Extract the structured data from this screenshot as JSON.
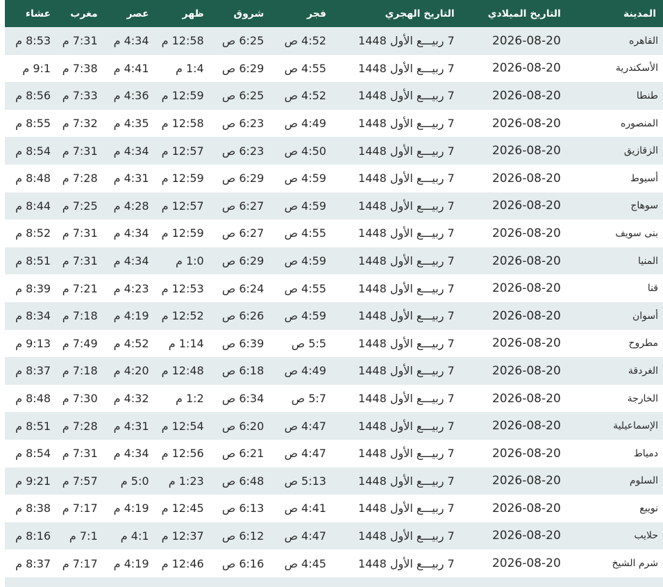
{
  "table": {
    "headers": {
      "city": "المدينة",
      "gregorian": "التاريخ الميلادي",
      "hijri": "التاريخ الهجري",
      "fajr": "فجر",
      "shuruq": "شروق",
      "dhuhr": "ظهر",
      "asr": "عصر",
      "maghrib": "مغرب",
      "isha": "عشاء"
    },
    "rows": [
      {
        "city": "القاهره",
        "gregorian": "2026-08-20",
        "hijri": "7 ربيـــع الأول 1448",
        "fajr": "4:52 ص",
        "shuruq": "6:25 ص",
        "dhuhr": "12:58 م",
        "asr": "4:34 م",
        "maghrib": "7:31 م",
        "isha": "8:53 م"
      },
      {
        "city": "الأسكندرية",
        "gregorian": "2026-08-20",
        "hijri": "7 ربيـــع الأول 1448",
        "fajr": "4:55 ص",
        "shuruq": "6:29 ص",
        "dhuhr": "1:4 م",
        "asr": "4:41 م",
        "maghrib": "7:38 م",
        "isha": "9:1 م"
      },
      {
        "city": "طنطا",
        "gregorian": "2026-08-20",
        "hijri": "7 ربيـــع الأول 1448",
        "fajr": "4:52 ص",
        "shuruq": "6:25 ص",
        "dhuhr": "12:59 م",
        "asr": "4:36 م",
        "maghrib": "7:33 م",
        "isha": "8:56 م"
      },
      {
        "city": "المنصوره",
        "gregorian": "2026-08-20",
        "hijri": "7 ربيـــع الأول 1448",
        "fajr": "4:49 ص",
        "shuruq": "6:23 ص",
        "dhuhr": "12:58 م",
        "asr": "4:35 م",
        "maghrib": "7:32 م",
        "isha": "8:55 م"
      },
      {
        "city": "الزقازيق",
        "gregorian": "2026-08-20",
        "hijri": "7 ربيـــع الأول 1448",
        "fajr": "4:50 ص",
        "shuruq": "6:23 ص",
        "dhuhr": "12:57 م",
        "asr": "4:34 م",
        "maghrib": "7:31 م",
        "isha": "8:54 م"
      },
      {
        "city": "أسيوط",
        "gregorian": "2026-08-20",
        "hijri": "7 ربيـــع الأول 1448",
        "fajr": "4:59 ص",
        "shuruq": "6:29 ص",
        "dhuhr": "12:59 م",
        "asr": "4:31 م",
        "maghrib": "7:28 م",
        "isha": "8:48 م"
      },
      {
        "city": "سوهاج",
        "gregorian": "2026-08-20",
        "hijri": "7 ربيـــع الأول 1448",
        "fajr": "4:59 ص",
        "shuruq": "6:27 ص",
        "dhuhr": "12:57 م",
        "asr": "4:28 م",
        "maghrib": "7:25 م",
        "isha": "8:44 م"
      },
      {
        "city": "بنى سويف",
        "gregorian": "2026-08-20",
        "hijri": "7 ربيـــع الأول 1448",
        "fajr": "4:55 ص",
        "shuruq": "6:27 ص",
        "dhuhr": "12:59 م",
        "asr": "4:34 م",
        "maghrib": "7:31 م",
        "isha": "8:52 م"
      },
      {
        "city": "المنيا",
        "gregorian": "2026-08-20",
        "hijri": "7 ربيـــع الأول 1448",
        "fajr": "4:59 ص",
        "shuruq": "6:29 ص",
        "dhuhr": "1:0 م",
        "asr": "4:34 م",
        "maghrib": "7:31 م",
        "isha": "8:51 م"
      },
      {
        "city": "قنا",
        "gregorian": "2026-08-20",
        "hijri": "7 ربيـــع الأول 1448",
        "fajr": "4:55 ص",
        "shuruq": "6:24 ص",
        "dhuhr": "12:53 م",
        "asr": "4:23 م",
        "maghrib": "7:21 م",
        "isha": "8:39 م"
      },
      {
        "city": "أسوان",
        "gregorian": "2026-08-20",
        "hijri": "7 ربيـــع الأول 1448",
        "fajr": "4:59 ص",
        "shuruq": "6:26 ص",
        "dhuhr": "12:52 م",
        "asr": "4:19 م",
        "maghrib": "7:18 م",
        "isha": "8:34 م"
      },
      {
        "city": "مطروح",
        "gregorian": "2026-08-20",
        "hijri": "7 ربيـــع الأول 1448",
        "fajr": "5:5 ص",
        "shuruq": "6:39 ص",
        "dhuhr": "1:14 م",
        "asr": "4:52 م",
        "maghrib": "7:49 م",
        "isha": "9:13 م"
      },
      {
        "city": "الغردقة",
        "gregorian": "2026-08-20",
        "hijri": "7 ربيـــع الأول 1448",
        "fajr": "4:49 ص",
        "shuruq": "6:18 ص",
        "dhuhr": "12:48 م",
        "asr": "4:20 م",
        "maghrib": "7:18 م",
        "isha": "8:37 م"
      },
      {
        "city": "الخارجة",
        "gregorian": "2026-08-20",
        "hijri": "7 ربيـــع الأول 1448",
        "fajr": "5:7 ص",
        "shuruq": "6:34 ص",
        "dhuhr": "1:2 م",
        "asr": "4:32 م",
        "maghrib": "7:30 م",
        "isha": "8:48 م"
      },
      {
        "city": "الإسماعيلية",
        "gregorian": "2026-08-20",
        "hijri": "7 ربيـــع الأول 1448",
        "fajr": "4:47 ص",
        "shuruq": "6:20 ص",
        "dhuhr": "12:54 م",
        "asr": "4:31 م",
        "maghrib": "7:28 م",
        "isha": "8:51 م"
      },
      {
        "city": "دمياط",
        "gregorian": "2026-08-20",
        "hijri": "7 ربيـــع الأول 1448",
        "fajr": "4:47 ص",
        "shuruq": "6:21 ص",
        "dhuhr": "12:56 م",
        "asr": "4:34 م",
        "maghrib": "7:31 م",
        "isha": "8:54 م"
      },
      {
        "city": "السلوم",
        "gregorian": "2026-08-20",
        "hijri": "7 ربيـــع الأول 1448",
        "fajr": "5:13 ص",
        "shuruq": "6:48 ص",
        "dhuhr": "1:23 م",
        "asr": "5:0 م",
        "maghrib": "7:57 م",
        "isha": "9:21 م"
      },
      {
        "city": "نويبع",
        "gregorian": "2026-08-20",
        "hijri": "7 ربيـــع الأول 1448",
        "fajr": "4:41 ص",
        "shuruq": "6:13 ص",
        "dhuhr": "12:45 م",
        "asr": "4:19 م",
        "maghrib": "7:17 م",
        "isha": "8:38 م"
      },
      {
        "city": "حلايب",
        "gregorian": "2026-08-20",
        "hijri": "7 ربيـــع الأول 1448",
        "fajr": "4:47 ص",
        "shuruq": "6:12 ص",
        "dhuhr": "12:37 م",
        "asr": "4:1 م",
        "maghrib": "7:1 م",
        "isha": "8:16 م"
      },
      {
        "city": "شرم الشيخ",
        "gregorian": "2026-08-20",
        "hijri": "7 ربيـــع الأول 1448",
        "fajr": "4:45 ص",
        "shuruq": "6:16 ص",
        "dhuhr": "12:46 م",
        "asr": "4:19 م",
        "maghrib": "7:17 م",
        "isha": "8:37 م"
      }
    ]
  },
  "colors": {
    "header_bg": "#1f5e4c",
    "header_text": "#ffffff",
    "row_odd_bg": "#e5ecee",
    "row_even_bg": "#ffffff",
    "cell_text": "#2a2a2a"
  }
}
